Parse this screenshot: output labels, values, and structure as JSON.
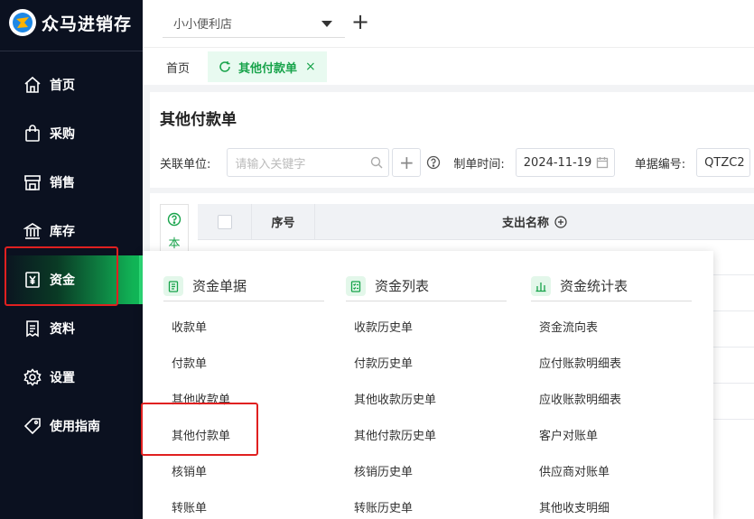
{
  "app": {
    "name": "众马进销存"
  },
  "sidebar": {
    "items": [
      {
        "label": "首页",
        "icon": "home-icon"
      },
      {
        "label": "采购",
        "icon": "shopping-bag-icon"
      },
      {
        "label": "销售",
        "icon": "store-icon"
      },
      {
        "label": "库存",
        "icon": "warehouse-icon"
      },
      {
        "label": "资金",
        "icon": "yen-icon",
        "active": true
      },
      {
        "label": "资料",
        "icon": "document-icon"
      },
      {
        "label": "设置",
        "icon": "gear-icon"
      },
      {
        "label": "使用指南",
        "icon": "tag-icon"
      }
    ]
  },
  "topbar": {
    "store": "小小便利店",
    "add_symbol": "+"
  },
  "tabs": [
    {
      "label": "首页"
    },
    {
      "label": "其他付款单",
      "active": true,
      "close": "×"
    }
  ],
  "page": {
    "title": "其他付款单",
    "filters": {
      "unit_label": "关联单位:",
      "unit_placeholder": "请输入关键字",
      "add_symbol": "+",
      "date_label": "制单时间:",
      "date_value": "2024-11-19",
      "docno_label": "单据编号:",
      "docno_value": "QTZC2"
    },
    "side_help_text": "本",
    "table": {
      "columns": [
        "序号",
        "支出名称"
      ]
    }
  },
  "dropdown": {
    "columns": [
      {
        "title": "资金单据",
        "items": [
          "收款单",
          "付款单",
          "其他收款单",
          "其他付款单",
          "核销单",
          "转账单"
        ]
      },
      {
        "title": "资金列表",
        "items": [
          "收款历史单",
          "付款历史单",
          "其他收款历史单",
          "其他付款历史单",
          "核销历史单",
          "转账历史单"
        ]
      },
      {
        "title": "资金统计表",
        "items": [
          "资金流向表",
          "应付账款明细表",
          "应收账款明细表",
          "客户对账单",
          "供应商对账单",
          "其他收支明细"
        ]
      }
    ]
  },
  "colors": {
    "accent": "#17a34a",
    "sidebar_bg": "#0b1120",
    "highlight": "#e02020"
  }
}
